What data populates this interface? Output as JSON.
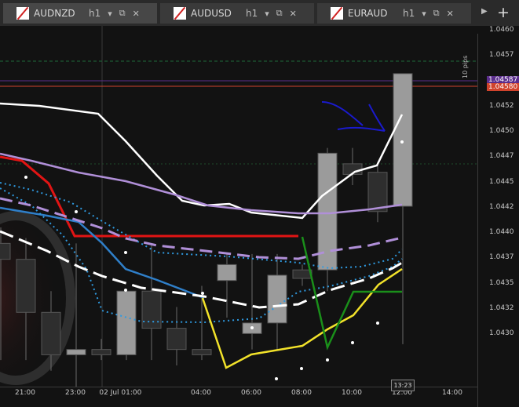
{
  "tabs": [
    {
      "symbol": "AUDNZD",
      "timeframe": "h1",
      "active": true
    },
    {
      "symbol": "AUDUSD",
      "timeframe": "h1",
      "active": false
    },
    {
      "symbol": "EURAUD",
      "timeframe": "h1",
      "active": false
    }
  ],
  "toolbar": {
    "add_tab_glyph": "+",
    "scroll_glyph": "▶"
  },
  "y_axis": {
    "ticks": [
      "1.0460",
      "1.0457",
      "1.0455",
      "1.0452",
      "1.0450",
      "1.0447",
      "1.0445",
      "1.0442",
      "1.0440",
      "1.0437",
      "1.0435",
      "1.0432",
      "1.0430"
    ]
  },
  "price_tags": [
    {
      "label": "1.04587",
      "color": "#5b2e8c"
    },
    {
      "label": "1.04580",
      "color": "#d0432c"
    }
  ],
  "measure_label": "10 pips",
  "x_axis": {
    "ticks": [
      "21:00",
      "23:00",
      "02 Jul 01:00",
      "04:00",
      "06:00",
      "08:00",
      "10:00",
      "12:00",
      "14:00"
    ]
  },
  "crosshair_time": "13:23",
  "colors": {
    "background": "#121212",
    "bullish": "#9b9b9b",
    "bearish": "#2e2e2e",
    "ma_red": "#e11414",
    "ma_blue": "#2f7fc9",
    "ma_white": "#ffffff",
    "ma_purple": "#b08fd8",
    "ma_yellow": "#f2e22a",
    "ma_green": "#1a8f1a",
    "drawing": "#1a1acc"
  },
  "chart_data": {
    "type": "candlestick",
    "symbol": "AUDNZD",
    "timeframe": "h1",
    "x": [
      "20:00",
      "21:00",
      "22:00",
      "23:00",
      "00:00",
      "01:00",
      "02:00",
      "03:00",
      "04:00",
      "05:00",
      "06:00",
      "07:00",
      "08:00",
      "09:00",
      "10:00",
      "11:00",
      "12:00"
    ],
    "open": [
      1.0442,
      1.04405,
      1.04355,
      1.04315,
      1.0432,
      1.04315,
      1.04375,
      1.0434,
      1.0432,
      1.04385,
      1.04335,
      1.04345,
      1.04395,
      1.04395,
      1.04495,
      1.04487,
      1.04455
    ],
    "high": [
      1.04435,
      1.04425,
      1.04375,
      1.0442,
      1.0433,
      1.0434,
      1.0442,
      1.0436,
      1.0438,
      1.0441,
      1.0441,
      1.0441,
      1.044,
      1.0451,
      1.0451,
      1.04495,
      1.0458
    ],
    "low": [
      1.0431,
      1.0431,
      1.043,
      1.0428,
      1.0431,
      1.0431,
      1.0431,
      1.04305,
      1.0431,
      1.0435,
      1.0432,
      1.0432,
      1.0438,
      1.04375,
      1.04475,
      1.0444,
      1.04325
    ],
    "close": [
      1.04405,
      1.04355,
      1.04315,
      1.0432,
      1.04315,
      1.04375,
      1.0434,
      1.0432,
      1.04315,
      1.044,
      1.04345,
      1.0439,
      1.04387,
      1.04505,
      1.04485,
      1.0445,
      1.0458
    ],
    "ylim": [
      1.04285,
      1.04625
    ],
    "current_price": 1.0458
  }
}
